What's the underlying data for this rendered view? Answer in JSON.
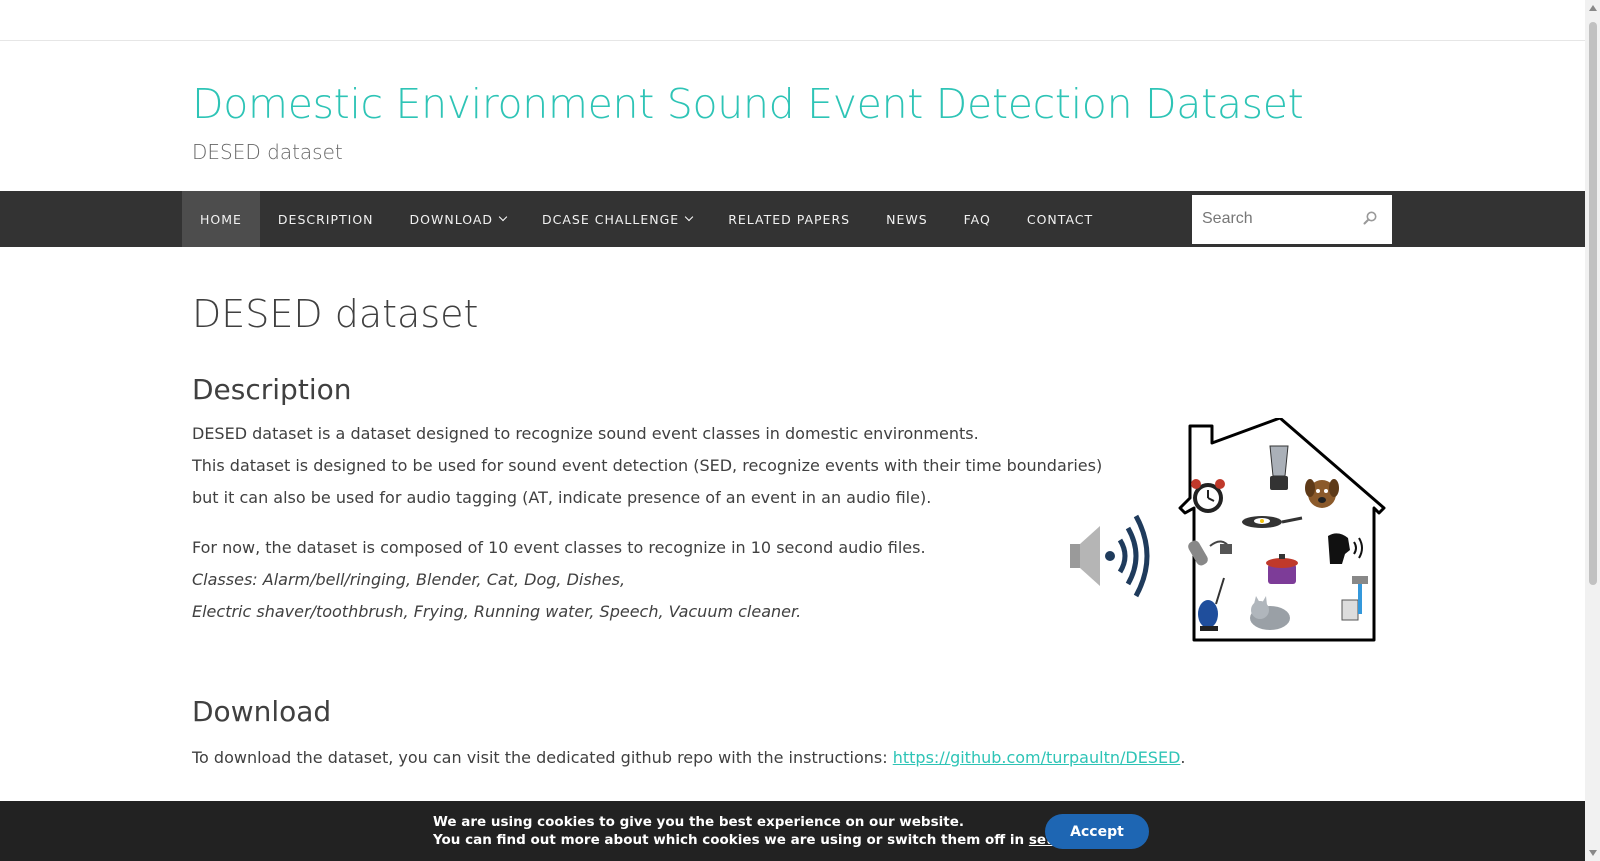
{
  "site": {
    "title": "Domestic Environment Sound Event Detection Dataset",
    "tagline": "DESED dataset"
  },
  "nav": {
    "items": [
      {
        "label": "HOME",
        "active": true
      },
      {
        "label": "DESCRIPTION"
      },
      {
        "label": "DOWNLOAD",
        "dropdown": true
      },
      {
        "label": "DCASE CHALLENGE",
        "dropdown": true
      },
      {
        "label": "RELATED PAPERS"
      },
      {
        "label": "NEWS"
      },
      {
        "label": "FAQ"
      },
      {
        "label": "CONTACT"
      }
    ],
    "search_placeholder": "Search"
  },
  "page": {
    "title": "DESED dataset",
    "description": {
      "heading": "Description",
      "p1": "DESED dataset is a dataset designed to recognize sound event classes in domestic environments.",
      "p2": "This dataset is designed to be used for sound event detection (SED, recognize events with their time boundaries)",
      "p3": "but it can also be used for audio tagging (AT, indicate presence of an event in an audio file).",
      "p4": "For now, the dataset is composed of 10 event classes to recognize in 10 second audio files.",
      "classes_line1": "Classes: Alarm/bell/ringing, Blender, Cat, Dog, Dishes,",
      "classes_line2": "Electric shaver/toothbrush, Frying, Running water, Speech, Vacuum cleaner."
    },
    "download": {
      "heading": "Download",
      "text": "To download the dataset, you can visit the dedicated github repo with the instructions: ",
      "link": "https://github.com/turpaultn/DESED",
      "end": "."
    }
  },
  "cookie": {
    "line1": "We are using cookies to give you the best experience on our website.",
    "line2": "You can find out more about which cookies we are using or switch them off in ",
    "settings_link": "settings",
    "line2_end": ".",
    "accept_label": "Accept"
  },
  "colors": {
    "accent": "#2ec4b6",
    "nav_bg": "#333333",
    "cookie_bg": "#222222",
    "accept_bg": "#1e66b3"
  }
}
